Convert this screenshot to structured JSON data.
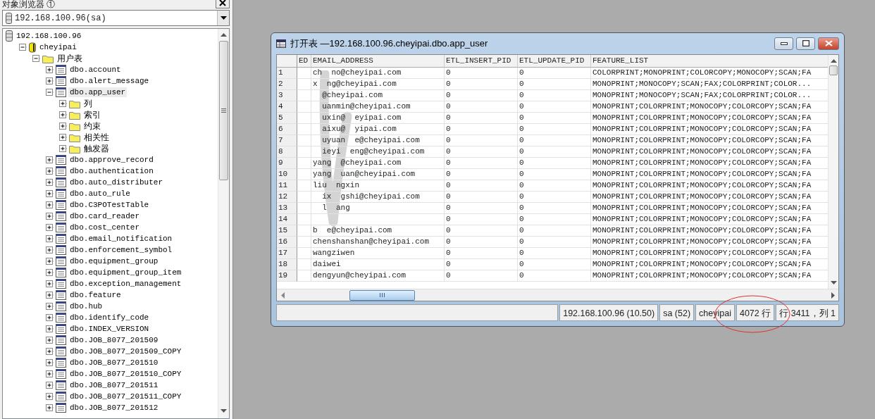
{
  "explorer": {
    "title": "对象浏览器 ①",
    "server_combo": "192.168.100.96(sa)",
    "tree": [
      {
        "label": "192.168.100.96",
        "kind": "server",
        "children": [
          {
            "label": "cheyipai",
            "kind": "database",
            "expanded": true,
            "children": [
              {
                "label": "用户表",
                "kind": "folder",
                "expanded": true,
                "children": [
                  {
                    "label": "dbo.account",
                    "kind": "table",
                    "expanded": false,
                    "selected": false
                  },
                  {
                    "label": "dbo.alert_message",
                    "kind": "table",
                    "expanded": false,
                    "selected": false
                  },
                  {
                    "label": "dbo.app_user",
                    "kind": "table",
                    "expanded": true,
                    "selected": true,
                    "children": [
                      {
                        "label": "列",
                        "kind": "folder",
                        "expanded": false
                      },
                      {
                        "label": "索引",
                        "kind": "folder",
                        "expanded": false
                      },
                      {
                        "label": "约束",
                        "kind": "folder",
                        "expanded": false
                      },
                      {
                        "label": "相关性",
                        "kind": "folder",
                        "expanded": false
                      },
                      {
                        "label": "触发器",
                        "kind": "folder",
                        "expanded": false
                      }
                    ]
                  },
                  {
                    "label": "dbo.approve_record",
                    "kind": "table",
                    "expanded": false,
                    "selected": false
                  },
                  {
                    "label": "dbo.authentication",
                    "kind": "table",
                    "expanded": false,
                    "selected": false
                  },
                  {
                    "label": "dbo.auto_distributer",
                    "kind": "table",
                    "expanded": false,
                    "selected": false
                  },
                  {
                    "label": "dbo.auto_rule",
                    "kind": "table",
                    "expanded": false,
                    "selected": false
                  },
                  {
                    "label": "dbo.C3POTestTable",
                    "kind": "table",
                    "expanded": false,
                    "selected": false
                  },
                  {
                    "label": "dbo.card_reader",
                    "kind": "table",
                    "expanded": false,
                    "selected": false
                  },
                  {
                    "label": "dbo.cost_center",
                    "kind": "table",
                    "expanded": false,
                    "selected": false
                  },
                  {
                    "label": "dbo.email_notification",
                    "kind": "table",
                    "expanded": false,
                    "selected": false
                  },
                  {
                    "label": "dbo.enforcement_symbol",
                    "kind": "table",
                    "expanded": false,
                    "selected": false
                  },
                  {
                    "label": "dbo.equipment_group",
                    "kind": "table",
                    "expanded": false,
                    "selected": false
                  },
                  {
                    "label": "dbo.equipment_group_item",
                    "kind": "table",
                    "expanded": false,
                    "selected": false
                  },
                  {
                    "label": "dbo.exception_management",
                    "kind": "table",
                    "expanded": false,
                    "selected": false
                  },
                  {
                    "label": "dbo.feature",
                    "kind": "table",
                    "expanded": false,
                    "selected": false
                  },
                  {
                    "label": "dbo.hub",
                    "kind": "table",
                    "expanded": false,
                    "selected": false
                  },
                  {
                    "label": "dbo.identify_code",
                    "kind": "table",
                    "expanded": false,
                    "selected": false
                  },
                  {
                    "label": "dbo.INDEX_VERSION",
                    "kind": "table",
                    "expanded": false,
                    "selected": false
                  },
                  {
                    "label": "dbo.JOB_8077_201509",
                    "kind": "table",
                    "expanded": false,
                    "selected": false
                  },
                  {
                    "label": "dbo.JOB_8077_201509_COPY",
                    "kind": "table",
                    "expanded": false,
                    "selected": false
                  },
                  {
                    "label": "dbo.JOB_8077_201510",
                    "kind": "table",
                    "expanded": false,
                    "selected": false
                  },
                  {
                    "label": "dbo.JOB_8077_201510_COPY",
                    "kind": "table",
                    "expanded": false,
                    "selected": false
                  },
                  {
                    "label": "dbo.JOB_8077_201511",
                    "kind": "table",
                    "expanded": false,
                    "selected": false
                  },
                  {
                    "label": "dbo.JOB_8077_201511_COPY",
                    "kind": "table",
                    "expanded": false,
                    "selected": false
                  },
                  {
                    "label": "dbo.JOB_8077_201512",
                    "kind": "table",
                    "expanded": false,
                    "selected": false
                  }
                ]
              }
            ]
          }
        ]
      }
    ]
  },
  "window": {
    "title": "打开表 —192.168.100.96.cheyipai.dbo.app_user",
    "columns": [
      "ED",
      "EMAIL_ADDRESS",
      "ETL_INSERT_PID",
      "ETL_UPDATE_PID",
      "FEATURE_LIST"
    ],
    "rows": [
      {
        "number": "1",
        "cells": [
          "",
          "ch  no@cheyipai.com",
          "0",
          "0",
          "COLORPRINT;MONOPRINT;COLORCOPY;MONOCOPY;SCAN;FA"
        ]
      },
      {
        "number": "2",
        "cells": [
          "",
          "x  ng@cheyipai.com",
          "0",
          "0",
          "MONOPRINT;MONOCOPY;SCAN;FAX;COLORPRINT;COLOR..."
        ]
      },
      {
        "number": "3",
        "cells": [
          "",
          "  @cheyipai.com",
          "0",
          "0",
          "MONOPRINT;MONOCOPY;SCAN;FAX;COLORPRINT;COLOR..."
        ]
      },
      {
        "number": "4",
        "cells": [
          "",
          "  uanmin@cheyipai.com",
          "0",
          "0",
          "MONOPRINT;COLORPRINT;MONOCOPY;COLORCOPY;SCAN;FA"
        ]
      },
      {
        "number": "5",
        "cells": [
          "",
          "  uxin@  eyipai.com",
          "0",
          "0",
          "MONOPRINT;COLORPRINT;MONOCOPY;COLORCOPY;SCAN;FA"
        ]
      },
      {
        "number": "6",
        "cells": [
          "",
          "  aixu@  yipai.com",
          "0",
          "0",
          "MONOPRINT;COLORPRINT;MONOCOPY;COLORCOPY;SCAN;FA"
        ]
      },
      {
        "number": "7",
        "cells": [
          "",
          "  uyuan  e@cheyipai.com",
          "0",
          "0",
          "MONOPRINT;COLORPRINT;MONOCOPY;COLORCOPY;SCAN;FA"
        ]
      },
      {
        "number": "8",
        "cells": [
          "",
          "  ieyi  eng@cheyipai.com",
          "0",
          "0",
          "MONOPRINT;COLORPRINT;MONOCOPY;COLORCOPY;SCAN;FA"
        ]
      },
      {
        "number": "9",
        "cells": [
          "",
          "yang  @cheyipai.com",
          "0",
          "0",
          "MONOPRINT;COLORPRINT;MONOCOPY;COLORCOPY;SCAN;FA"
        ]
      },
      {
        "number": "10",
        "cells": [
          "",
          "yang  uan@cheyipai.com",
          "0",
          "0",
          "MONOPRINT;COLORPRINT;MONOCOPY;COLORCOPY;SCAN;FA"
        ]
      },
      {
        "number": "11",
        "cells": [
          "",
          "liu  ngxin",
          "0",
          "0",
          "MONOPRINT;COLORPRINT;MONOCOPY;COLORCOPY;SCAN;FA"
        ]
      },
      {
        "number": "12",
        "cells": [
          "",
          "  ix  gshi@cheyipai.com",
          "0",
          "0",
          "MONOPRINT;COLORPRINT;MONOCOPY;COLORCOPY;SCAN;FA"
        ]
      },
      {
        "number": "13",
        "cells": [
          "",
          "  l  ang",
          "0",
          "0",
          "MONOPRINT;COLORPRINT;MONOCOPY;COLORCOPY;SCAN;FA"
        ]
      },
      {
        "number": "14",
        "cells": [
          "",
          "",
          "0",
          "0",
          "MONOPRINT;COLORPRINT;MONOCOPY;COLORCOPY;SCAN;FA"
        ]
      },
      {
        "number": "15",
        "cells": [
          "",
          "b  e@cheyipai.com",
          "0",
          "0",
          "MONOPRINT;COLORPRINT;MONOCOPY;COLORCOPY;SCAN;FA"
        ]
      },
      {
        "number": "16",
        "cells": [
          "",
          "chenshanshan@cheyipai.com",
          "0",
          "0",
          "MONOPRINT;COLORPRINT;MONOCOPY;COLORCOPY;SCAN;FA"
        ]
      },
      {
        "number": "17",
        "cells": [
          "",
          "wangziwen",
          "0",
          "0",
          "MONOPRINT;COLORPRINT;MONOCOPY;COLORCOPY;SCAN;FA"
        ]
      },
      {
        "number": "18",
        "cells": [
          "",
          "daiwei",
          "0",
          "0",
          "MONOPRINT;COLORPRINT;MONOCOPY;COLORCOPY;SCAN;FA"
        ]
      },
      {
        "number": "19",
        "cells": [
          "",
          "dengyun@cheyipai.com",
          "0",
          "0",
          "MONOPRINT;COLORPRINT;MONOCOPY;COLORCOPY;SCAN;FA"
        ]
      }
    ],
    "status_bar": [
      "192.168.100.96 (10.50)",
      "sa (52)",
      "cheyipai",
      "4072 行",
      "行 3411，列 1"
    ]
  }
}
